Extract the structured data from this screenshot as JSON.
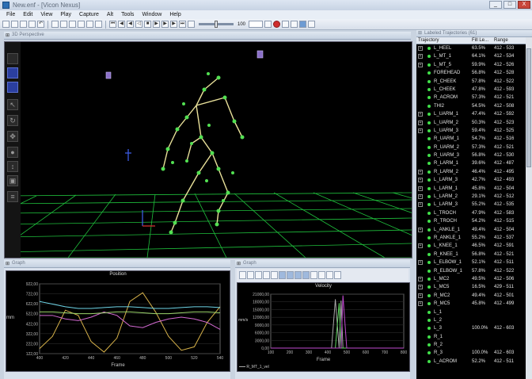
{
  "window": {
    "title": "New.enf - [Vicon Nexus]",
    "buttons": [
      "_",
      "□",
      "X"
    ]
  },
  "menu": [
    "File",
    "Edit",
    "View",
    "Play",
    "Capture",
    "Alt",
    "Tools",
    "Window",
    "Help"
  ],
  "toolbar": {
    "fps_value": "100"
  },
  "viewport": {
    "title": "3D Perspective"
  },
  "position_graph": {
    "panel_title": "Graph",
    "chart_title": "Position",
    "ylabel": "mm",
    "xlabel": "Frame",
    "yticks": [
      "922,00",
      "722,00",
      "622,00",
      "522,00",
      "422,00",
      "322,00",
      "222,00",
      "122,00"
    ],
    "xticks": [
      "400",
      "420",
      "440",
      "460",
      "480",
      "500",
      "520",
      "540"
    ]
  },
  "velocity_graph": {
    "panel_title": "Graph",
    "chart_title": "Velocity",
    "ylabel": "mm/s",
    "xlabel": "Frame",
    "yticks": [
      "21000,00",
      "18000,00",
      "15000,00",
      "12000,00",
      "9000,00",
      "6000,00",
      "3000,00",
      "0,00"
    ],
    "xticks": [
      "100",
      "200",
      "300",
      "400",
      "500",
      "600",
      "700",
      "800"
    ],
    "legend": "R_MT_1_vel"
  },
  "chart_data": [
    {
      "type": "line",
      "title": "Position",
      "xlabel": "Frame",
      "ylabel": "mm",
      "x": [
        400,
        410,
        420,
        430,
        440,
        450,
        460,
        470,
        480,
        490,
        500,
        510,
        520,
        530,
        540
      ],
      "series": [
        {
          "color": "#d7b24a",
          "values": [
            180,
            320,
            620,
            560,
            260,
            140,
            300,
            720,
            820,
            600,
            320,
            160,
            200,
            480,
            660
          ]
        },
        {
          "color": "#6fd6e8",
          "values": [
            720,
            690,
            660,
            640,
            640,
            650,
            660,
            660,
            650,
            640,
            640,
            650,
            660,
            660,
            650
          ]
        },
        {
          "color": "#d36ad2",
          "values": [
            560,
            560,
            520,
            500,
            540,
            600,
            560,
            440,
            420,
            480,
            520,
            540,
            520,
            480,
            400
          ]
        },
        {
          "color": "#9ad46a",
          "values": [
            600,
            600,
            590,
            580,
            580,
            590,
            600,
            600,
            590,
            580,
            580,
            590,
            600,
            600,
            590
          ]
        }
      ],
      "ylim": [
        122,
        922
      ]
    },
    {
      "type": "line",
      "title": "Velocity",
      "xlabel": "Frame",
      "ylabel": "mm/s",
      "x": [
        100,
        200,
        300,
        400,
        420,
        440,
        460,
        470,
        480,
        500,
        520,
        600,
        700,
        800
      ],
      "series": [
        {
          "name": "R_MT_1_vel",
          "color": "#a8a8a8",
          "values": [
            0,
            0,
            0,
            0,
            0,
            19000,
            0,
            18500,
            0,
            0,
            0,
            0,
            0,
            0
          ]
        },
        {
          "color": "#5fd65f",
          "values": [
            0,
            0,
            0,
            0,
            0,
            0,
            17500,
            0,
            0,
            0,
            0,
            0,
            0,
            0
          ]
        },
        {
          "color": "#c04ad0",
          "values": [
            0,
            0,
            0,
            0,
            0,
            0,
            0,
            0,
            20500,
            0,
            0,
            0,
            0,
            0
          ]
        }
      ],
      "ylim": [
        0,
        21000
      ]
    }
  ],
  "trajectories": {
    "panel_title": "Labeled Trajectories (61)",
    "columns": [
      "Trajectory",
      "Fill Le...",
      "Range"
    ],
    "rows": [
      {
        "name": "L_HEEL",
        "fill": "63.5%",
        "range": "412 - 533",
        "exp": true
      },
      {
        "name": "L_MT_1",
        "fill": "64.1%",
        "range": "412 - 534",
        "exp": true
      },
      {
        "name": "L_MT_5",
        "fill": "59.9%",
        "range": "412 - 526",
        "exp": true
      },
      {
        "name": "FOREHEAD",
        "fill": "56.8%",
        "range": "412 - 528",
        "exp": false
      },
      {
        "name": "R_CHEEK",
        "fill": "57.8%",
        "range": "412 - 522",
        "exp": false
      },
      {
        "name": "L_CHEEK",
        "fill": "47.8%",
        "range": "412 - 593",
        "exp": false
      },
      {
        "name": "R_ACROM",
        "fill": "57.3%",
        "range": "412 - 521",
        "exp": false
      },
      {
        "name": "THI2",
        "fill": "54.5%",
        "range": "412 - 508",
        "exp": false
      },
      {
        "name": "L_UARM_1",
        "fill": "47.4%",
        "range": "412 - 592",
        "exp": true
      },
      {
        "name": "L_UARM_2",
        "fill": "50.3%",
        "range": "412 - 523",
        "exp": true
      },
      {
        "name": "L_UARM_3",
        "fill": "59.4%",
        "range": "412 - 525",
        "exp": true
      },
      {
        "name": "R_UARM_1",
        "fill": "54.7%",
        "range": "412 - 516",
        "exp": false
      },
      {
        "name": "R_UARM_2",
        "fill": "57.3%",
        "range": "412 - 521",
        "exp": false
      },
      {
        "name": "R_UARM_3",
        "fill": "56.8%",
        "range": "412 - 530",
        "exp": false
      },
      {
        "name": "R_LARM_1",
        "fill": "39.6%",
        "range": "412 - 487",
        "exp": false
      },
      {
        "name": "R_LARM_2",
        "fill": "46.4%",
        "range": "412 - 495",
        "exp": true
      },
      {
        "name": "L_LARM_3",
        "fill": "42.7%",
        "range": "412 - 493",
        "exp": true
      },
      {
        "name": "L_LARM_1",
        "fill": "45.8%",
        "range": "412 - 504",
        "exp": true
      },
      {
        "name": "L_LARM_2",
        "fill": "29.1%",
        "range": "412 - 512",
        "exp": true
      },
      {
        "name": "L_LARM_3",
        "fill": "55.2%",
        "range": "412 - 535",
        "exp": true
      },
      {
        "name": "L_TROCH",
        "fill": "47.9%",
        "range": "412 - 583",
        "exp": false
      },
      {
        "name": "R_TROCH",
        "fill": "54.2%",
        "range": "412 - 515",
        "exp": false
      },
      {
        "name": "L_ANKLE_1",
        "fill": "49.4%",
        "range": "412 - 504",
        "exp": true
      },
      {
        "name": "R_ANKLE_1",
        "fill": "55.2%",
        "range": "412 - 537",
        "exp": false
      },
      {
        "name": "L_KNEE_1",
        "fill": "46.5%",
        "range": "412 - 591",
        "exp": true
      },
      {
        "name": "R_KNEE_1",
        "fill": "56.8%",
        "range": "412 - 521",
        "exp": false
      },
      {
        "name": "L_ELBOW_1",
        "fill": "52.1%",
        "range": "412 - 511",
        "exp": true
      },
      {
        "name": "R_ELBOW_1",
        "fill": "57.8%",
        "range": "412 - 522",
        "exp": false
      },
      {
        "name": "L_MC2",
        "fill": "49.5%",
        "range": "412 - 506",
        "exp": true
      },
      {
        "name": "L_MC5",
        "fill": "16.5%",
        "range": "429 - 511",
        "exp": true
      },
      {
        "name": "R_MC2",
        "fill": "49.4%",
        "range": "412 - 501",
        "exp": true
      },
      {
        "name": "R_MC5",
        "fill": "45.8%",
        "range": "412 - 499",
        "exp": true
      },
      {
        "name": "L_1",
        "fill": "",
        "range": "",
        "exp": false
      },
      {
        "name": "L_2",
        "fill": "",
        "range": "",
        "exp": false
      },
      {
        "name": "L_3",
        "fill": "100.0%",
        "range": "412 - 603",
        "exp": false
      },
      {
        "name": "R_1",
        "fill": "",
        "range": "",
        "exp": false
      },
      {
        "name": "R_2",
        "fill": "",
        "range": "",
        "exp": false
      },
      {
        "name": "R_3",
        "fill": "100.0%",
        "range": "412 - 603",
        "exp": false
      },
      {
        "name": "L_ACROM",
        "fill": "52.2%",
        "range": "412 - 511",
        "exp": false
      }
    ]
  }
}
